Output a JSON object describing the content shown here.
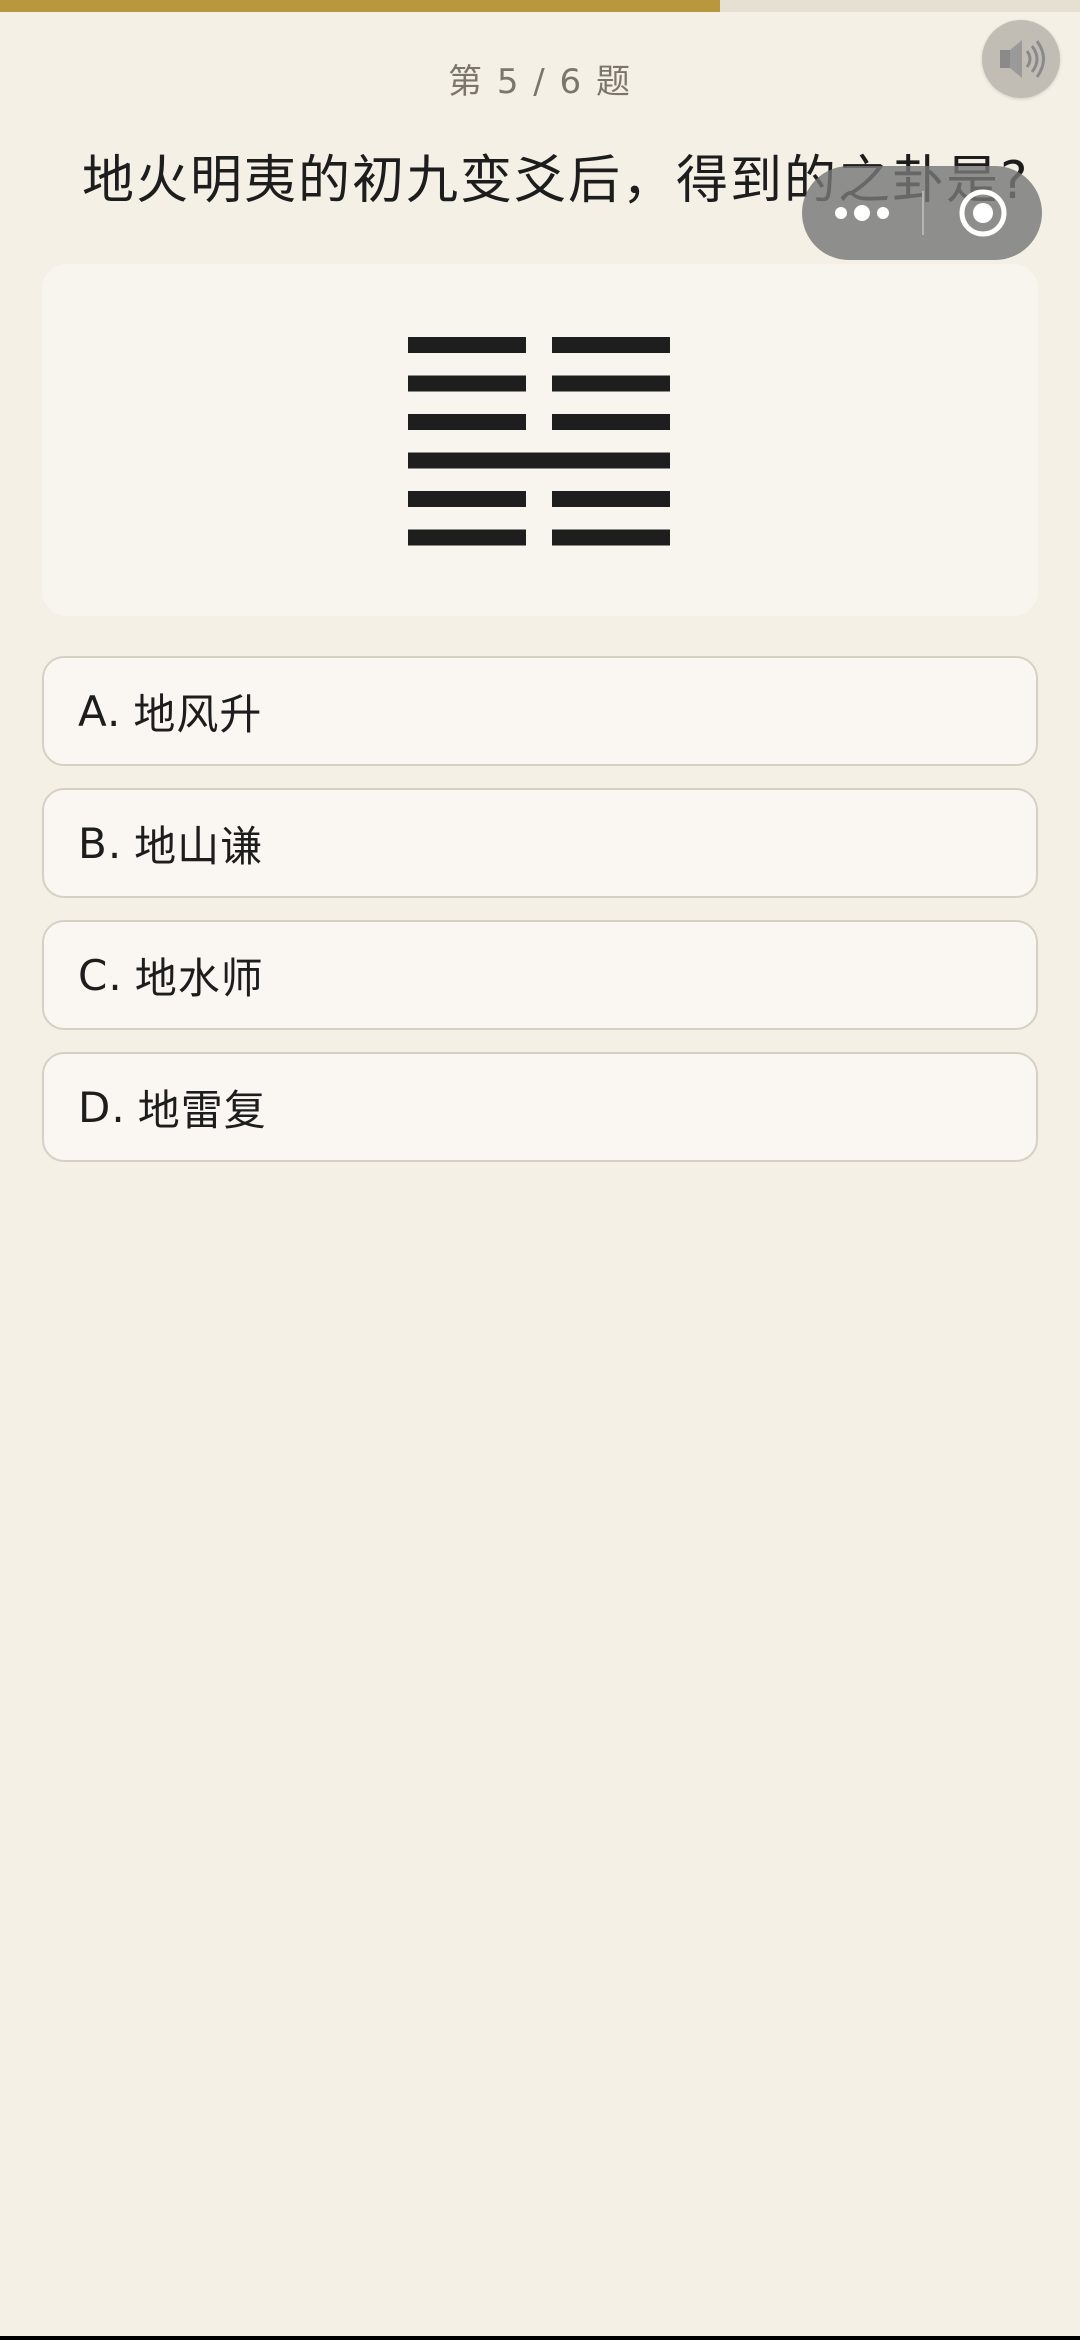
{
  "progress": {
    "fraction": 0.667
  },
  "header": {
    "counter": "第 5 / 6 题",
    "sound_icon": "speaker-icon"
  },
  "question": {
    "text": "地火明夷的初九变爻后，得到的之卦是?"
  },
  "capsule": {
    "more_icon": "more-dots-icon",
    "close_icon": "target-circle-icon"
  },
  "hexagram": {
    "lines_top_to_bottom": [
      "broken",
      "broken",
      "broken",
      "solid",
      "broken",
      "broken"
    ]
  },
  "options": [
    {
      "letter": "A.",
      "text": "地风升"
    },
    {
      "letter": "B.",
      "text": "地山谦"
    },
    {
      "letter": "C.",
      "text": "地水师"
    },
    {
      "letter": "D.",
      "text": "地雷复"
    }
  ],
  "colors": {
    "background": "#f4f0e6",
    "accent": "#b8983c",
    "text": "#1d1d1d"
  }
}
